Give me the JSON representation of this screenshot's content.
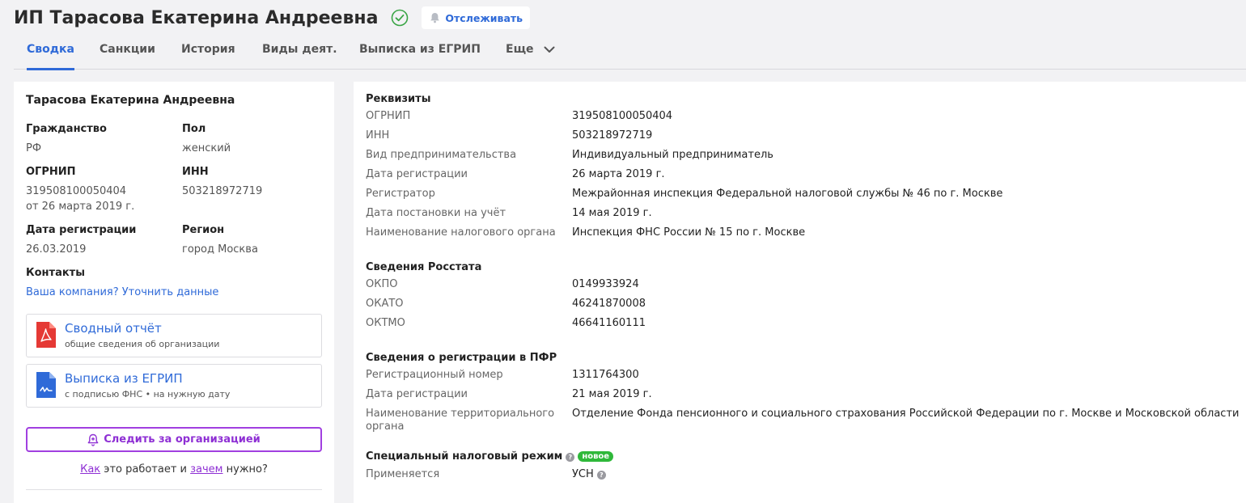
{
  "header": {
    "title": "ИП Тарасова Екатерина Андреевна",
    "track_label": "Отслеживать"
  },
  "tabs": [
    {
      "label": "Сводка",
      "active": true
    },
    {
      "label": "Санкции"
    },
    {
      "label": "История"
    },
    {
      "label": "Виды деят."
    },
    {
      "label": "Выписка из ЕГРИП"
    },
    {
      "label": "Еще"
    }
  ],
  "left": {
    "name": "Тарасова Екатерина Андреевна",
    "citizenship_label": "Гражданство",
    "citizenship_value": "РФ",
    "sex_label": "Пол",
    "sex_value": "женский",
    "ogrnip_label": "ОГРНИП",
    "ogrnip_value": "319508100050404",
    "ogrnip_date": "от 26 марта 2019 г.",
    "inn_label": "ИНН",
    "inn_value": "503218972719",
    "reg_date_label": "Дата регистрации",
    "reg_date_value": "26.03.2019",
    "region_label": "Регион",
    "region_value": "город Москва",
    "contacts_label": "Контакты",
    "contacts_link": "Ваша компания? Уточнить данные",
    "report_title": "Сводный отчёт",
    "report_sub": "общие сведения об организации",
    "extract_title": "Выписка из ЕГРИП",
    "extract_sub": "с подписью ФНС • на нужную дату",
    "follow_label": "Следить за организацией",
    "howto": {
      "link1": "Как",
      "text1": " это работает и ",
      "link2": "зачем",
      "text2": " нужно?"
    }
  },
  "right": {
    "requisites": {
      "title": "Реквизиты",
      "rows": [
        {
          "label": "ОГРНИП",
          "value": "319508100050404"
        },
        {
          "label": "ИНН",
          "value": "503218972719"
        },
        {
          "label": "Вид предпринимательства",
          "value": "Индивидуальный предприниматель"
        },
        {
          "label": "Дата регистрации",
          "value": "26 марта 2019 г."
        },
        {
          "label": "Регистратор",
          "value": "Межрайонная инспекция Федеральной налоговой службы № 46 по г. Москве"
        },
        {
          "label": "Дата постановки на учёт",
          "value": "14 мая 2019 г."
        },
        {
          "label": "Наименование налогового органа",
          "value": "Инспекция ФНС России № 15 по г. Москве"
        }
      ]
    },
    "rosstat": {
      "title": "Сведения Росстата",
      "rows": [
        {
          "label": "ОКПО",
          "value": "0149933924"
        },
        {
          "label": "ОКАТО",
          "value": "46241870008"
        },
        {
          "label": "ОКТМО",
          "value": "46641160111"
        }
      ]
    },
    "pfr": {
      "title": "Сведения о регистрации в ПФР",
      "rows": [
        {
          "label": "Регистрационный номер",
          "value": "1311764300"
        },
        {
          "label": "Дата регистрации",
          "value": "21 мая 2019 г."
        },
        {
          "label_line1": "Наименование территориального",
          "label_line2": "органа",
          "value": "Отделение Фонда пенсионного и социального страхования Российской Федерации по г. Москве и Московской области"
        }
      ]
    },
    "tax_regime": {
      "title": "Специальный налоговый режим",
      "badge": "новое",
      "row_label": "Применяется",
      "row_value": "УСН"
    }
  },
  "colors": {
    "accent": "#2f6ad8",
    "purple": "#8e2fd4",
    "green": "#2fb83a",
    "pdf_red": "#e53935"
  }
}
